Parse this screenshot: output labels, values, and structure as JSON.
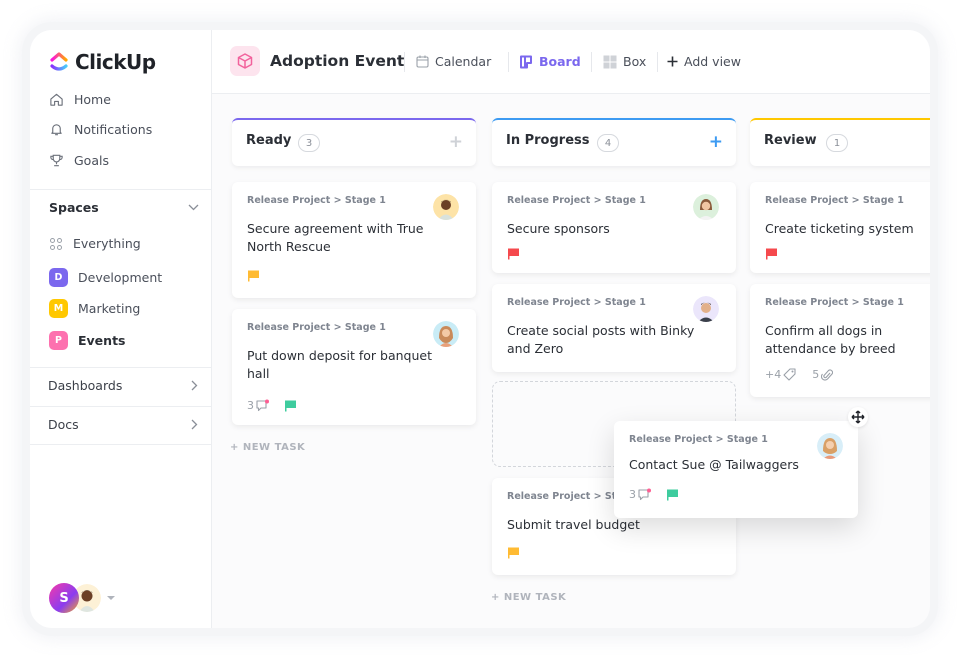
{
  "app": {
    "name": "ClickUp"
  },
  "sidebar": {
    "nav": [
      {
        "label": "Home",
        "icon": "home-icon"
      },
      {
        "label": "Notifications",
        "icon": "bell-icon"
      },
      {
        "label": "Goals",
        "icon": "trophy-icon"
      }
    ],
    "spaces_label": "Spaces",
    "everything_label": "Everything",
    "spaces": [
      {
        "letter": "D",
        "label": "Development",
        "color": "#7b68ee"
      },
      {
        "letter": "M",
        "label": "Marketing",
        "color": "#ffc800"
      },
      {
        "letter": "P",
        "label": "Events",
        "color": "#fd71af",
        "active": true
      }
    ],
    "dashboards_label": "Dashboards",
    "docs_label": "Docs",
    "user_initial": "S"
  },
  "header": {
    "project_title": "Adoption Event",
    "views": [
      {
        "label": "Calendar",
        "icon": "calendar-icon"
      },
      {
        "label": "Board",
        "icon": "board-icon",
        "active": true
      },
      {
        "label": "Box",
        "icon": "box-icon"
      },
      {
        "label": "Add view",
        "icon": "plus-icon"
      }
    ]
  },
  "colors": {
    "accent": "#7b68ee",
    "ready": "#7b68ee",
    "in_progress": "#3d9bf2",
    "review": "#ffc800",
    "flag_yellow": "#ffbb33",
    "flag_red": "#f5494d",
    "flag_green": "#3ecc9e"
  },
  "board": {
    "new_task_label": "+ NEW TASK",
    "columns": [
      {
        "title": "Ready",
        "count": "3",
        "cards": [
          {
            "crumb": "Release Project > Stage 1",
            "title": "Secure agreement with True North Rescue",
            "flag": "yellow"
          },
          {
            "crumb": "Release Project > Stage 1",
            "title": "Put down deposit for banquet hall",
            "comments": "3",
            "flag": "green"
          }
        ]
      },
      {
        "title": "In Progress",
        "count": "4",
        "cards": [
          {
            "crumb": "Release Project > Stage 1",
            "title": "Secure sponsors",
            "flag": "red"
          },
          {
            "crumb": "Release Project > Stage 1",
            "title": "Create social posts with Binky and Zero"
          },
          {
            "crumb": "Release Project > Stage 1",
            "title": "Submit travel budget",
            "flag": "yellow"
          }
        ]
      },
      {
        "title": "Review",
        "count": "1",
        "cards": [
          {
            "crumb": "Release Project > Stage 1",
            "title": "Create ticketing system",
            "flag": "red"
          },
          {
            "crumb": "Release Project > Stage 1",
            "title": "Confirm all dogs in attendance by breed",
            "tags": "+4",
            "attachments": "5"
          }
        ]
      }
    ],
    "dragging_card": {
      "crumb": "Release Project > Stage 1",
      "title": "Contact Sue @ Tailwaggers",
      "comments": "3",
      "flag": "green"
    }
  }
}
